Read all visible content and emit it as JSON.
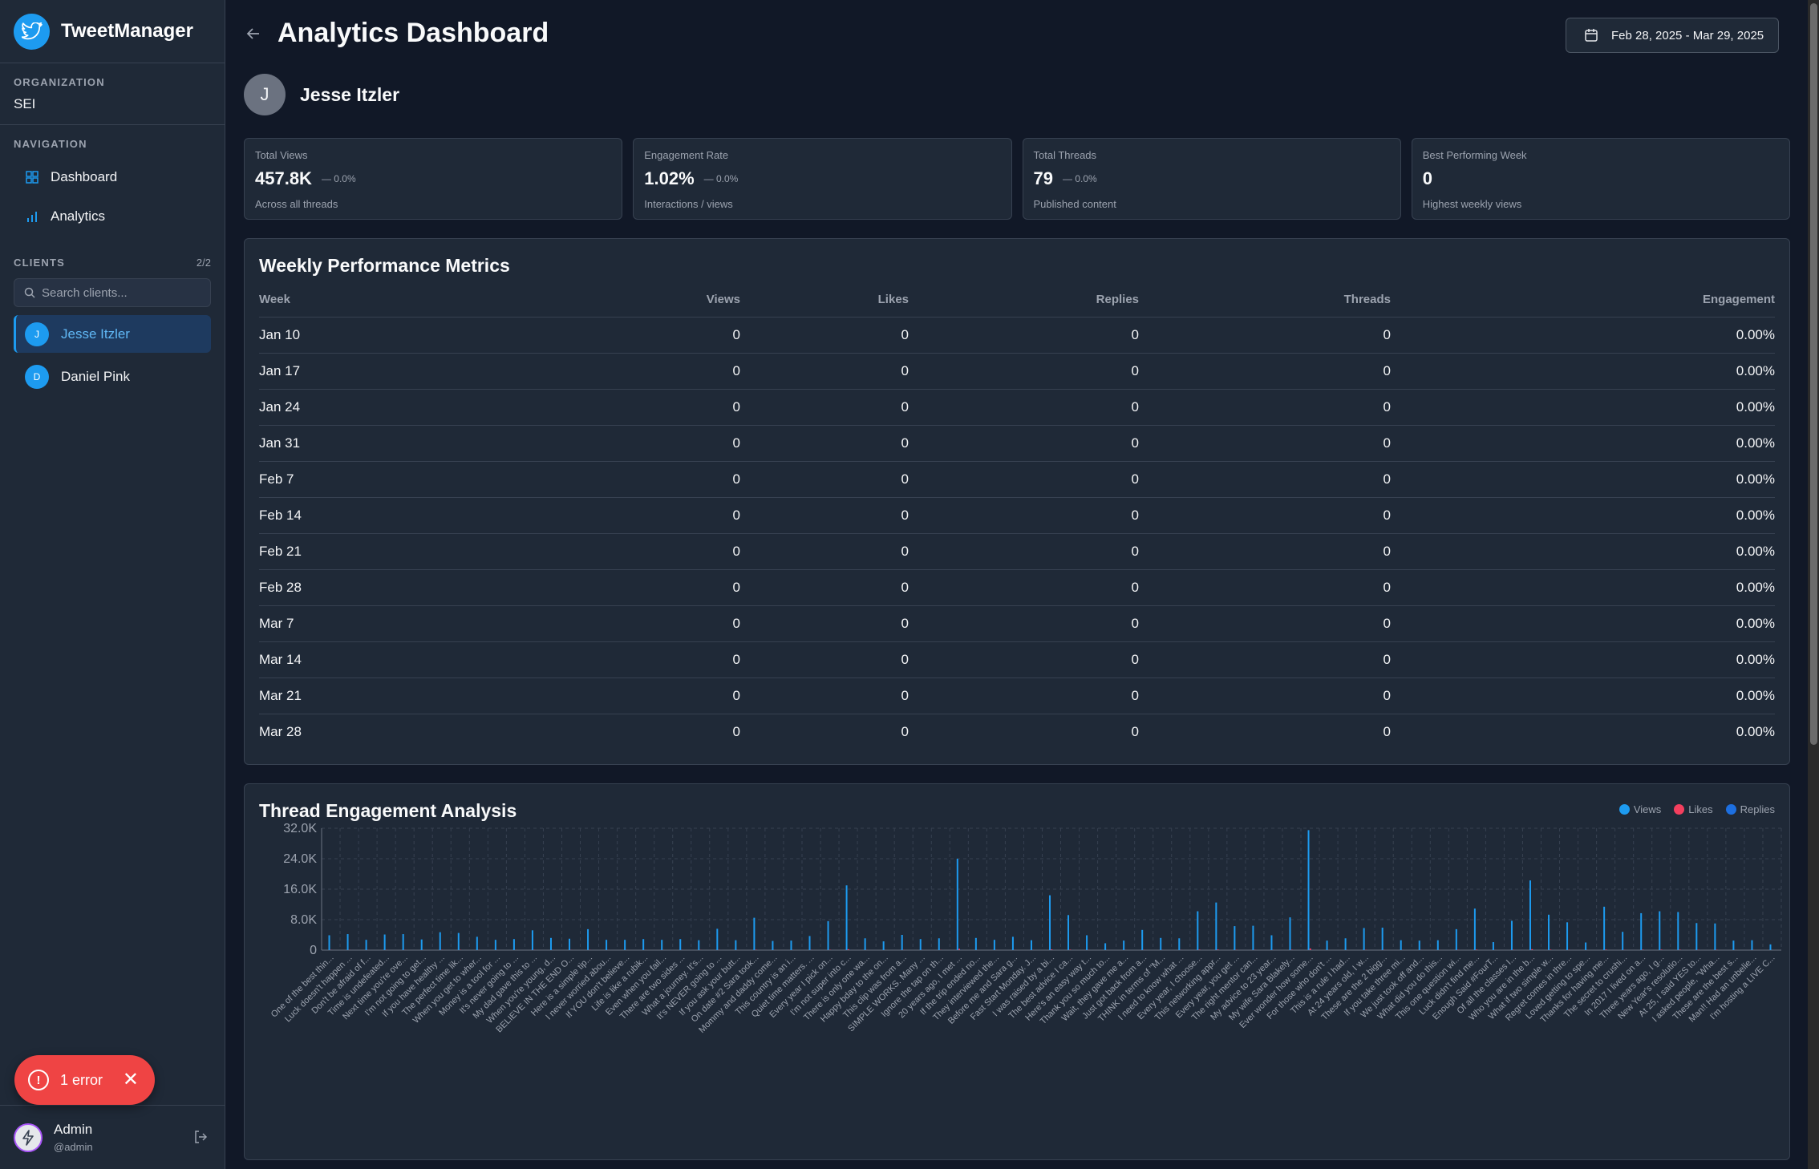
{
  "app": {
    "name": "TweetManager"
  },
  "organization": {
    "label": "ORGANIZATION",
    "value": "SEI"
  },
  "navigation": {
    "label": "NAVIGATION",
    "items": [
      {
        "label": "Dashboard",
        "icon": "grid-icon"
      },
      {
        "label": "Analytics",
        "icon": "bar-chart-icon"
      }
    ]
  },
  "clients": {
    "label": "CLIENTS",
    "count": "2/2",
    "search_placeholder": "Search clients...",
    "items": [
      {
        "initial": "J",
        "name": "Jesse Itzler",
        "active": true
      },
      {
        "initial": "D",
        "name": "Daniel Pink",
        "active": false
      }
    ]
  },
  "user": {
    "name": "Admin",
    "handle": "@admin"
  },
  "error_toast": {
    "label": "1 error",
    "color": "#ef4444"
  },
  "header": {
    "title": "Analytics Dashboard",
    "date_range": "Feb 28, 2025 - Mar 29, 2025"
  },
  "profile": {
    "initial": "J",
    "name": "Jesse Itzler"
  },
  "stats": [
    {
      "label": "Total Views",
      "value": "457.8K",
      "change": "0.0%",
      "sub": "Across all threads"
    },
    {
      "label": "Engagement Rate",
      "value": "1.02%",
      "change": "0.0%",
      "sub": "Interactions / views"
    },
    {
      "label": "Total Threads",
      "value": "79",
      "change": "0.0%",
      "sub": "Published content"
    },
    {
      "label": "Best Performing Week",
      "value": "0",
      "change": "",
      "sub": "Highest weekly views"
    }
  ],
  "weekly": {
    "title": "Weekly Performance Metrics",
    "columns": [
      "Week",
      "Views",
      "Likes",
      "Replies",
      "Threads",
      "Engagement"
    ],
    "rows": [
      [
        "Jan 10",
        "0",
        "0",
        "0",
        "0",
        "0.00%"
      ],
      [
        "Jan 17",
        "0",
        "0",
        "0",
        "0",
        "0.00%"
      ],
      [
        "Jan 24",
        "0",
        "0",
        "0",
        "0",
        "0.00%"
      ],
      [
        "Jan 31",
        "0",
        "0",
        "0",
        "0",
        "0.00%"
      ],
      [
        "Feb 7",
        "0",
        "0",
        "0",
        "0",
        "0.00%"
      ],
      [
        "Feb 14",
        "0",
        "0",
        "0",
        "0",
        "0.00%"
      ],
      [
        "Feb 21",
        "0",
        "0",
        "0",
        "0",
        "0.00%"
      ],
      [
        "Feb 28",
        "0",
        "0",
        "0",
        "0",
        "0.00%"
      ],
      [
        "Mar 7",
        "0",
        "0",
        "0",
        "0",
        "0.00%"
      ],
      [
        "Mar 14",
        "0",
        "0",
        "0",
        "0",
        "0.00%"
      ],
      [
        "Mar 21",
        "0",
        "0",
        "0",
        "0",
        "0.00%"
      ],
      [
        "Mar 28",
        "0",
        "0",
        "0",
        "0",
        "0.00%"
      ]
    ]
  },
  "engagement": {
    "title": "Thread Engagement Analysis",
    "legend": [
      {
        "label": "Views",
        "color": "#1d9bf0"
      },
      {
        "label": "Likes",
        "color": "#f43f5e"
      },
      {
        "label": "Replies",
        "color": "#1d6fe0"
      }
    ]
  },
  "chart_data": {
    "type": "bar",
    "ylim": [
      0,
      32000
    ],
    "yticks": [
      "0",
      "8.0K",
      "16.0K",
      "24.0K",
      "32.0K"
    ],
    "grid": true,
    "categories": [
      "One of the best thin...",
      "Luck doesn't happen ...",
      "Don't be afraid of f...",
      "Time is undefeated...",
      "Next time you're ove...",
      "I'm not going to get...",
      "If you have healthy ...",
      "The perfect time lik...",
      "When you get to wher...",
      "Money is a tool for ...",
      "It's never going to ...",
      "My dad gave this to ...",
      "When you're young, d...",
      "BELIEVE IN THE END O...",
      "Here is a simple tip...",
      "I never worried abou...",
      "If YOU don't believe...",
      "Life is like a rubik...",
      "Even when you fail...",
      "There are two sides ...",
      "What a journey. It's...",
      "It's NEVER going to ...",
      "If you ask your butt...",
      "On date #2 Sara took...",
      "Mommy and daddy come...",
      "This country is an i...",
      "Quiet time matters. ...",
      "Every year I pick on...",
      "I'm not super into c...",
      "There is only one wa...",
      "Happy bday to the on...",
      "This clip was from a...",
      "SIMPLE WORKS. Many ...",
      "Ignore the tap on th...",
      "20 years ago, I met ...",
      "If the trip ended no...",
      "They interviewed the...",
      "Before me and Sara g...",
      "Fast Start Monday. J...",
      "I was raised by a bi...",
      "The best advice I ca...",
      "Here's an easy way t...",
      "Thank you so much to...",
      "Wait, they gave me a...",
      "Just got back from a...",
      "THINK in terms of \"M...",
      "I need to know what ...",
      "Every year, I choose...",
      "This networking appr...",
      "Every year, you get ...",
      "The right mentor can...",
      "My advice to 23 year...",
      "My wife Sara Blakely...",
      "Ever wonder how some...",
      "For those who don't ...",
      "This is a rule I had...",
      "At 24 years old, I w...",
      "These are the 2 bigg...",
      "If you take three mi...",
      "We just took off and...",
      "What did you do this...",
      "This one question wi...",
      "Luck didn't find me...",
      "Enough Said #FourT...",
      "Of all the classes I...",
      "Who you are in the b...",
      "What if two simple w...",
      "Regret comes in thre...",
      "Loved getting to spe...",
      "Thanks for having me...",
      "The secret to crushi...",
      "In 2017 I lived on a...",
      "Three years ago, I g...",
      "New Year's resolutio...",
      "At 25, I said YES to...",
      "I asked people, \"Wha...",
      "These are the best s...",
      "Man!! Had an unbelie...",
      "I'm hosting a LIVE C..."
    ],
    "series": [
      {
        "name": "Views",
        "color": "#1d9bf0",
        "values": [
          3900,
          4200,
          2700,
          4100,
          4200,
          2800,
          4700,
          4500,
          3500,
          2700,
          2900,
          5200,
          3200,
          3000,
          5500,
          2700,
          2700,
          2900,
          2700,
          2900,
          2600,
          5600,
          2600,
          8500,
          2400,
          2500,
          3700,
          7600,
          17000,
          3100,
          2300,
          4000,
          2900,
          3100,
          24000,
          3200,
          2700,
          3500,
          2600,
          14400,
          9200,
          3900,
          1800,
          2500,
          5300,
          3200,
          3100,
          10200,
          12500,
          6300,
          6400,
          3900,
          8600,
          31500,
          2500,
          3100,
          5800,
          5900,
          2600,
          2500,
          2600,
          5500,
          10900,
          2100,
          7700,
          18300,
          9300,
          7300,
          2000,
          11400,
          4800,
          9700,
          10200,
          10000,
          7100,
          7000,
          2500,
          2600,
          1500,
          500
        ]
      },
      {
        "name": "Likes",
        "color": "#f43f5e",
        "values": [
          60,
          70,
          40,
          60,
          60,
          40,
          70,
          70,
          50,
          40,
          40,
          80,
          50,
          40,
          80,
          40,
          40,
          40,
          40,
          40,
          40,
          80,
          40,
          120,
          30,
          40,
          50,
          110,
          240,
          40,
          30,
          60,
          40,
          40,
          340,
          40,
          40,
          50,
          40,
          200,
          130,
          60,
          30,
          40,
          80,
          40,
          40,
          140,
          170,
          90,
          90,
          60,
          120,
          440,
          40,
          40,
          80,
          80,
          40,
          40,
          40,
          80,
          150,
          30,
          110,
          250,
          130,
          100,
          30,
          160,
          70,
          140,
          140,
          140,
          100,
          100,
          40,
          40,
          20,
          10
        ]
      },
      {
        "name": "Replies",
        "color": "#1d6fe0",
        "values": [
          5,
          5,
          3,
          5,
          5,
          3,
          6,
          6,
          4,
          3,
          3,
          7,
          4,
          4,
          7,
          3,
          3,
          4,
          3,
          4,
          3,
          7,
          3,
          10,
          3,
          3,
          5,
          9,
          20,
          4,
          3,
          5,
          4,
          4,
          29,
          4,
          3,
          4,
          3,
          17,
          11,
          5,
          2,
          3,
          6,
          4,
          4,
          12,
          15,
          8,
          8,
          5,
          10,
          38,
          3,
          4,
          7,
          7,
          3,
          3,
          3,
          7,
          13,
          3,
          9,
          22,
          11,
          9,
          2,
          14,
          6,
          12,
          12,
          12,
          9,
          8,
          3,
          3,
          2,
          1
        ]
      }
    ]
  }
}
